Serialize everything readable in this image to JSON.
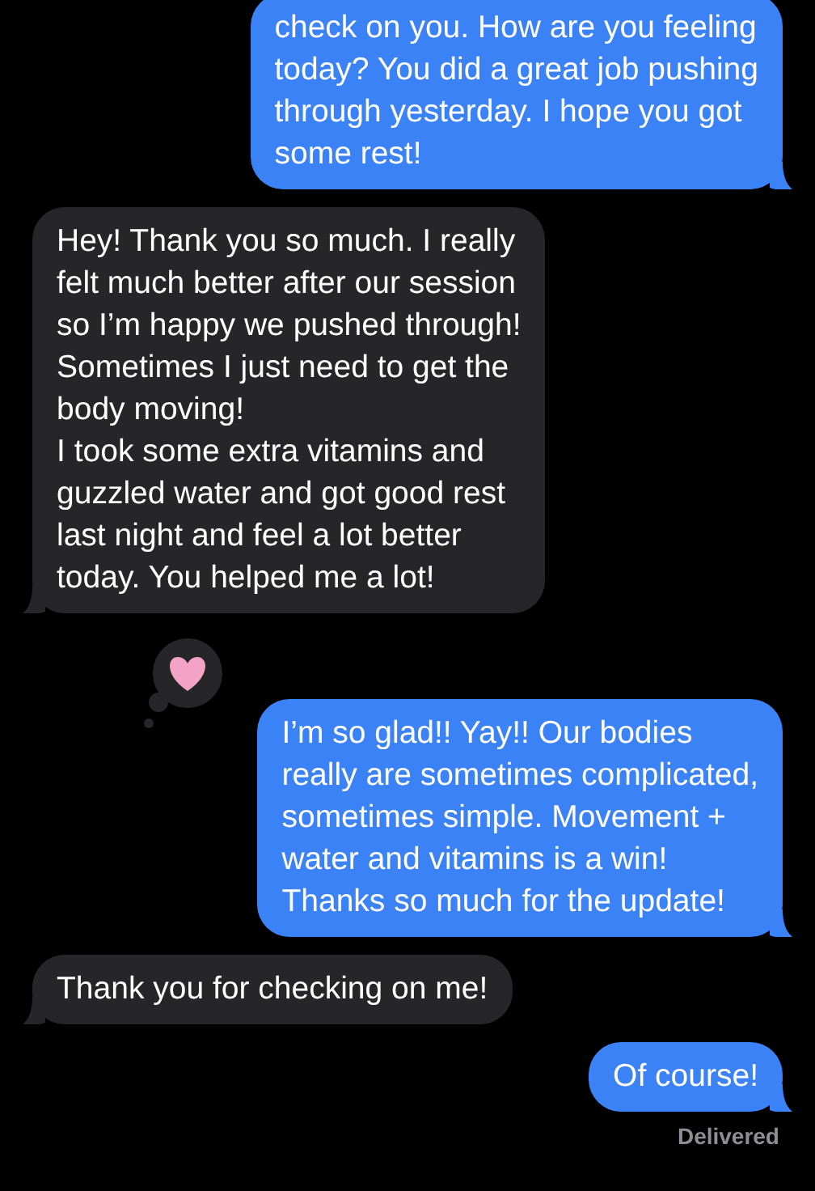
{
  "messages": [
    {
      "outgoing": true,
      "text": "check on you. How are you feeling\ntoday? You did a great job pushing\nthrough yesterday. I hope you got\nsome rest!"
    },
    {
      "outgoing": false,
      "text": "Hey! Thank you so much. I really\nfelt much better after our session\nso I’m happy we pushed through!\nSometimes I just need to get the\nbody moving!\nI took some extra vitamins and\nguzzled water and got good rest\nlast night and feel a lot better\ntoday. You helped me a lot!"
    },
    {
      "outgoing": true,
      "heart_reaction": true,
      "text": "I’m so glad!! Yay!! Our bodies\nreally are sometimes complicated,\nsometimes simple. Movement +\nwater and vitamins is a win!\nThanks so much for the update!"
    },
    {
      "outgoing": false,
      "text": "Thank you for checking on me!"
    },
    {
      "outgoing": true,
      "text": "Of course!"
    }
  ],
  "status": "Delivered"
}
